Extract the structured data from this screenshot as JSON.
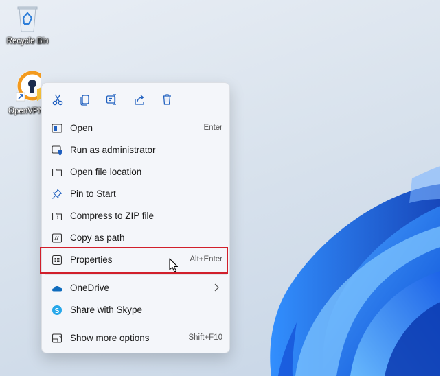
{
  "desktop": {
    "icons": [
      {
        "label": "Recycle Bin",
        "icon": "recycle-bin-icon"
      },
      {
        "label": "OpenVPN Connect",
        "icon": "openvpn-icon"
      }
    ]
  },
  "context_menu": {
    "toolbar": [
      {
        "name": "cut",
        "icon": "scissors-icon"
      },
      {
        "name": "copy",
        "icon": "copy-icon"
      },
      {
        "name": "rename",
        "icon": "rename-icon"
      },
      {
        "name": "share",
        "icon": "share-icon"
      },
      {
        "name": "delete",
        "icon": "trash-icon"
      }
    ],
    "items": [
      {
        "label": "Open",
        "shortcut": "Enter",
        "icon": "open-window-icon"
      },
      {
        "label": "Run as administrator",
        "shortcut": "",
        "icon": "shield-icon"
      },
      {
        "label": "Open file location",
        "shortcut": "",
        "icon": "folder-icon"
      },
      {
        "label": "Pin to Start",
        "shortcut": "",
        "icon": "pin-icon"
      },
      {
        "label": "Compress to ZIP file",
        "shortcut": "",
        "icon": "zip-folder-icon"
      },
      {
        "label": "Copy as path",
        "shortcut": "",
        "icon": "copy-path-icon"
      },
      {
        "label": "Properties",
        "shortcut": "Alt+Enter",
        "icon": "properties-icon"
      },
      {
        "label": "OneDrive",
        "shortcut": "",
        "icon": "onedrive-cloud-icon",
        "has_submenu": true
      },
      {
        "label": "Share with Skype",
        "shortcut": "",
        "icon": "skype-icon"
      },
      {
        "label": "Show more options",
        "shortcut": "Shift+F10",
        "icon": "more-options-icon"
      }
    ],
    "highlighted_item": "Properties",
    "highlight_color": "#d11f2b"
  },
  "colors": {
    "menu_background": "#f4f6fa",
    "accent_blue": "#0067c0",
    "wallpaper_blue": "#1a6ff0"
  }
}
